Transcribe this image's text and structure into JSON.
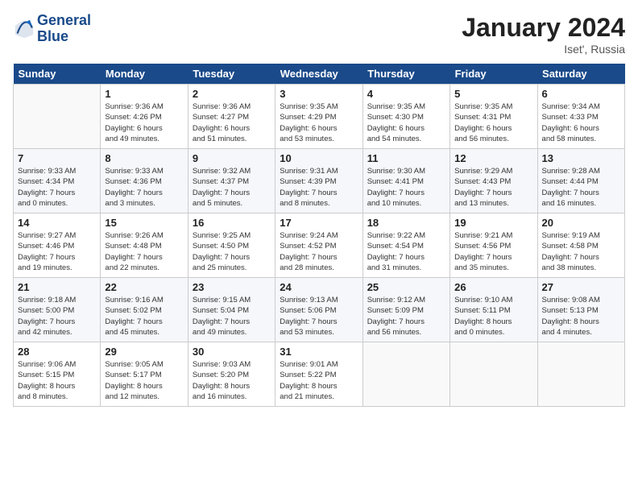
{
  "header": {
    "logo_line1": "General",
    "logo_line2": "Blue",
    "month_title": "January 2024",
    "location": "Iset', Russia"
  },
  "weekdays": [
    "Sunday",
    "Monday",
    "Tuesday",
    "Wednesday",
    "Thursday",
    "Friday",
    "Saturday"
  ],
  "weeks": [
    [
      {
        "day": "",
        "info": ""
      },
      {
        "day": "1",
        "info": "Sunrise: 9:36 AM\nSunset: 4:26 PM\nDaylight: 6 hours\nand 49 minutes."
      },
      {
        "day": "2",
        "info": "Sunrise: 9:36 AM\nSunset: 4:27 PM\nDaylight: 6 hours\nand 51 minutes."
      },
      {
        "day": "3",
        "info": "Sunrise: 9:35 AM\nSunset: 4:29 PM\nDaylight: 6 hours\nand 53 minutes."
      },
      {
        "day": "4",
        "info": "Sunrise: 9:35 AM\nSunset: 4:30 PM\nDaylight: 6 hours\nand 54 minutes."
      },
      {
        "day": "5",
        "info": "Sunrise: 9:35 AM\nSunset: 4:31 PM\nDaylight: 6 hours\nand 56 minutes."
      },
      {
        "day": "6",
        "info": "Sunrise: 9:34 AM\nSunset: 4:33 PM\nDaylight: 6 hours\nand 58 minutes."
      }
    ],
    [
      {
        "day": "7",
        "info": "Sunrise: 9:33 AM\nSunset: 4:34 PM\nDaylight: 7 hours\nand 0 minutes."
      },
      {
        "day": "8",
        "info": "Sunrise: 9:33 AM\nSunset: 4:36 PM\nDaylight: 7 hours\nand 3 minutes."
      },
      {
        "day": "9",
        "info": "Sunrise: 9:32 AM\nSunset: 4:37 PM\nDaylight: 7 hours\nand 5 minutes."
      },
      {
        "day": "10",
        "info": "Sunrise: 9:31 AM\nSunset: 4:39 PM\nDaylight: 7 hours\nand 8 minutes."
      },
      {
        "day": "11",
        "info": "Sunrise: 9:30 AM\nSunset: 4:41 PM\nDaylight: 7 hours\nand 10 minutes."
      },
      {
        "day": "12",
        "info": "Sunrise: 9:29 AM\nSunset: 4:43 PM\nDaylight: 7 hours\nand 13 minutes."
      },
      {
        "day": "13",
        "info": "Sunrise: 9:28 AM\nSunset: 4:44 PM\nDaylight: 7 hours\nand 16 minutes."
      }
    ],
    [
      {
        "day": "14",
        "info": "Sunrise: 9:27 AM\nSunset: 4:46 PM\nDaylight: 7 hours\nand 19 minutes."
      },
      {
        "day": "15",
        "info": "Sunrise: 9:26 AM\nSunset: 4:48 PM\nDaylight: 7 hours\nand 22 minutes."
      },
      {
        "day": "16",
        "info": "Sunrise: 9:25 AM\nSunset: 4:50 PM\nDaylight: 7 hours\nand 25 minutes."
      },
      {
        "day": "17",
        "info": "Sunrise: 9:24 AM\nSunset: 4:52 PM\nDaylight: 7 hours\nand 28 minutes."
      },
      {
        "day": "18",
        "info": "Sunrise: 9:22 AM\nSunset: 4:54 PM\nDaylight: 7 hours\nand 31 minutes."
      },
      {
        "day": "19",
        "info": "Sunrise: 9:21 AM\nSunset: 4:56 PM\nDaylight: 7 hours\nand 35 minutes."
      },
      {
        "day": "20",
        "info": "Sunrise: 9:19 AM\nSunset: 4:58 PM\nDaylight: 7 hours\nand 38 minutes."
      }
    ],
    [
      {
        "day": "21",
        "info": "Sunrise: 9:18 AM\nSunset: 5:00 PM\nDaylight: 7 hours\nand 42 minutes."
      },
      {
        "day": "22",
        "info": "Sunrise: 9:16 AM\nSunset: 5:02 PM\nDaylight: 7 hours\nand 45 minutes."
      },
      {
        "day": "23",
        "info": "Sunrise: 9:15 AM\nSunset: 5:04 PM\nDaylight: 7 hours\nand 49 minutes."
      },
      {
        "day": "24",
        "info": "Sunrise: 9:13 AM\nSunset: 5:06 PM\nDaylight: 7 hours\nand 53 minutes."
      },
      {
        "day": "25",
        "info": "Sunrise: 9:12 AM\nSunset: 5:09 PM\nDaylight: 7 hours\nand 56 minutes."
      },
      {
        "day": "26",
        "info": "Sunrise: 9:10 AM\nSunset: 5:11 PM\nDaylight: 8 hours\nand 0 minutes."
      },
      {
        "day": "27",
        "info": "Sunrise: 9:08 AM\nSunset: 5:13 PM\nDaylight: 8 hours\nand 4 minutes."
      }
    ],
    [
      {
        "day": "28",
        "info": "Sunrise: 9:06 AM\nSunset: 5:15 PM\nDaylight: 8 hours\nand 8 minutes."
      },
      {
        "day": "29",
        "info": "Sunrise: 9:05 AM\nSunset: 5:17 PM\nDaylight: 8 hours\nand 12 minutes."
      },
      {
        "day": "30",
        "info": "Sunrise: 9:03 AM\nSunset: 5:20 PM\nDaylight: 8 hours\nand 16 minutes."
      },
      {
        "day": "31",
        "info": "Sunrise: 9:01 AM\nSunset: 5:22 PM\nDaylight: 8 hours\nand 21 minutes."
      },
      {
        "day": "",
        "info": ""
      },
      {
        "day": "",
        "info": ""
      },
      {
        "day": "",
        "info": ""
      }
    ]
  ]
}
